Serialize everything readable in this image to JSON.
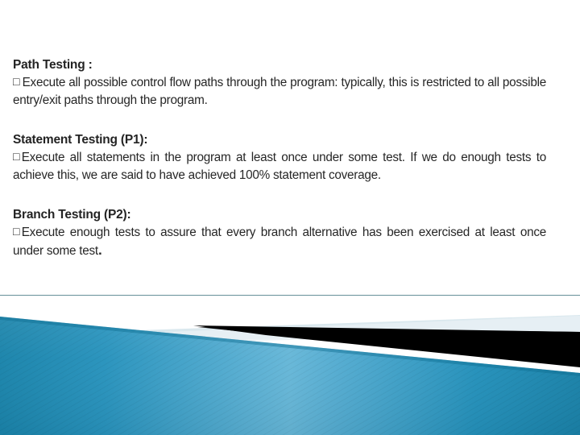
{
  "slide": {
    "background_color": "#ffffff",
    "divider_color": "#5d8a94",
    "blocks": [
      {
        "heading": "Path Testing :",
        "bullet": "□",
        "body": "Execute all possible control flow paths through the program: typically, this is restricted to all possible entry/exit paths through the program."
      },
      {
        "heading": "Statement Testing (P1):",
        "bullet": "□",
        "body": "Execute all statements in the program at least once under some test. If we do enough tests to achieve this, we are said to have achieved 100% statement coverage."
      },
      {
        "heading": "Branch Testing (P2):",
        "bullet": "□",
        "body": "Execute enough tests to assure that every branch alternative has been exercised at least once under some test",
        "body_tail": "."
      }
    ]
  },
  "decoration": {
    "name": "diagonal-wave-footer",
    "pale_band_color": "#dae8ee",
    "black_wedge_color": "#000000",
    "blue_light_color": "#63b4d6",
    "blue_mid_color": "#2f9bc4",
    "blue_dark_color": "#1a84ab"
  }
}
